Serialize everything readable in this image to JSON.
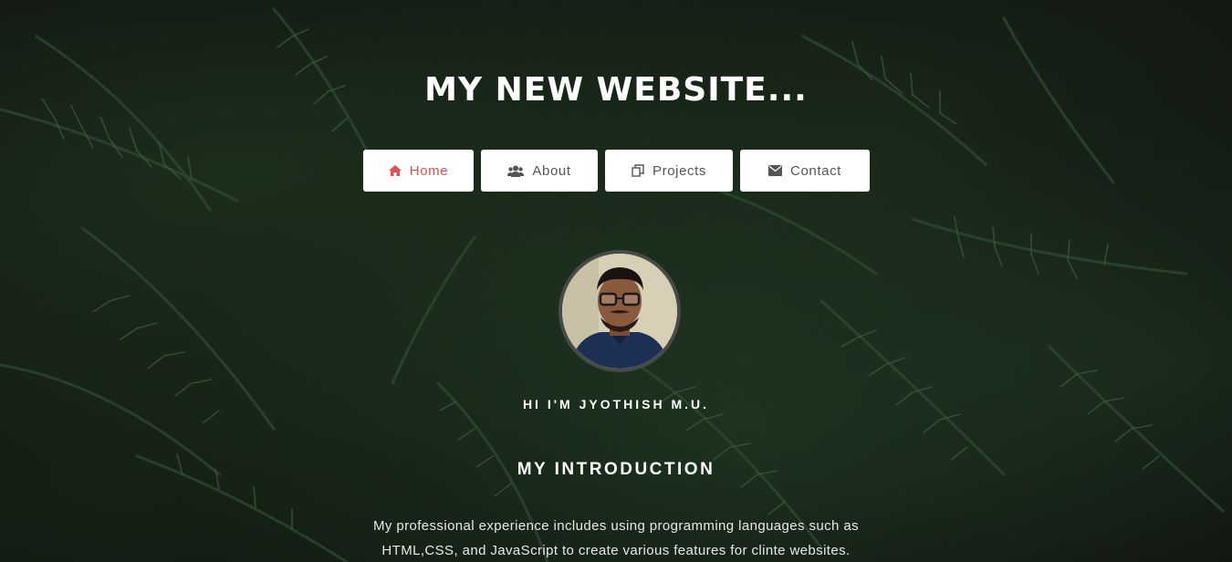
{
  "site": {
    "title": "MY NEW WEBSITE..."
  },
  "nav": {
    "items": [
      {
        "label": "Home",
        "icon": "home-icon",
        "active": true
      },
      {
        "label": "About",
        "icon": "users-icon",
        "active": false
      },
      {
        "label": "Projects",
        "icon": "copy-icon",
        "active": false
      },
      {
        "label": "Contact",
        "icon": "envelope-icon",
        "active": false
      }
    ]
  },
  "profile": {
    "greeting": "HI I'M JYOTHISH M.U."
  },
  "intro": {
    "heading": "MY INTRODUCTION",
    "text": "My professional experience includes using programming languages such as HTML,CSS, and JavaScript to create various features for clinte websites."
  },
  "colors": {
    "accent": "#e04f4f",
    "nav_text": "#555555",
    "background": "#0f120f"
  }
}
